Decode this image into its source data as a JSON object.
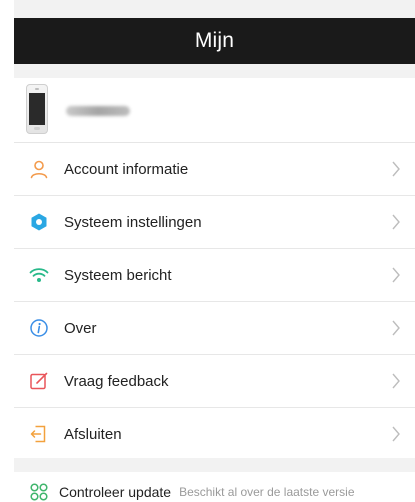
{
  "header": {
    "title": "Mijn"
  },
  "profile": {
    "device_image": "phone-device-icon"
  },
  "menu": {
    "items": [
      {
        "label": "Account informatie",
        "icon": "person-icon",
        "icon_color": "#f39a4b"
      },
      {
        "label": "Systeem instellingen",
        "icon": "settings-hex-icon",
        "icon_color": "#2aa7e3"
      },
      {
        "label": "Systeem bericht",
        "icon": "wifi-icon",
        "icon_color": "#28b98a"
      },
      {
        "label": "Over",
        "icon": "info-icon",
        "icon_color": "#3a8ee6"
      },
      {
        "label": "Vraag feedback",
        "icon": "feedback-edit-icon",
        "icon_color": "#e9555a"
      },
      {
        "label": "Afsluiten",
        "icon": "logout-icon",
        "icon_color": "#f3a13d"
      }
    ]
  },
  "update": {
    "label": "Controleer update",
    "status": "Beschikt al over de laatste versie",
    "icon": "update-icon",
    "icon_color": "#3fb56c"
  }
}
